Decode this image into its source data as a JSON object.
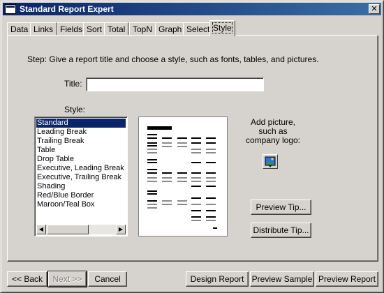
{
  "window": {
    "title": "Standard Report Expert",
    "close_glyph": "✕"
  },
  "tabs": [
    {
      "label": "Data"
    },
    {
      "label": "Links"
    },
    {
      "label": "Fields"
    },
    {
      "label": "Sort"
    },
    {
      "label": "Total"
    },
    {
      "label": "TopN"
    },
    {
      "label": "Graph"
    },
    {
      "label": "Select"
    },
    {
      "label": "Style",
      "active": true
    }
  ],
  "style_tab": {
    "step_text": "Step:  Give a report title and choose a style, such as fonts, tables, and pictures.",
    "title_label": "Title:",
    "title_value": "",
    "style_label": "Style:",
    "styles": [
      "Standard",
      "Leading Break",
      "Trailing Break",
      "Table",
      "Drop Table",
      "Executive, Leading Break",
      "Executive, Trailing Break",
      "Shading",
      "Red/Blue Border",
      "Maroon/Teal Box"
    ],
    "selected_style": "Standard",
    "add_picture_line1": "Add picture,",
    "add_picture_line2": "such as",
    "add_picture_line3": "company logo:",
    "preview_tip_label": "Preview Tip...",
    "distribute_tip_label": "Distribute Tip..."
  },
  "footer": {
    "back_label": "<< Back",
    "next_label": "Next >>",
    "cancel_label": "Cancel",
    "design_report_label": "Design Report",
    "preview_sample_label": "Preview Sample",
    "preview_report_label": "Preview Report"
  },
  "colors": {
    "face": "#d6d3ce",
    "titlebar_start": "#0a246a",
    "titlebar_end": "#3a6ea5",
    "selection": "#0a246a"
  }
}
